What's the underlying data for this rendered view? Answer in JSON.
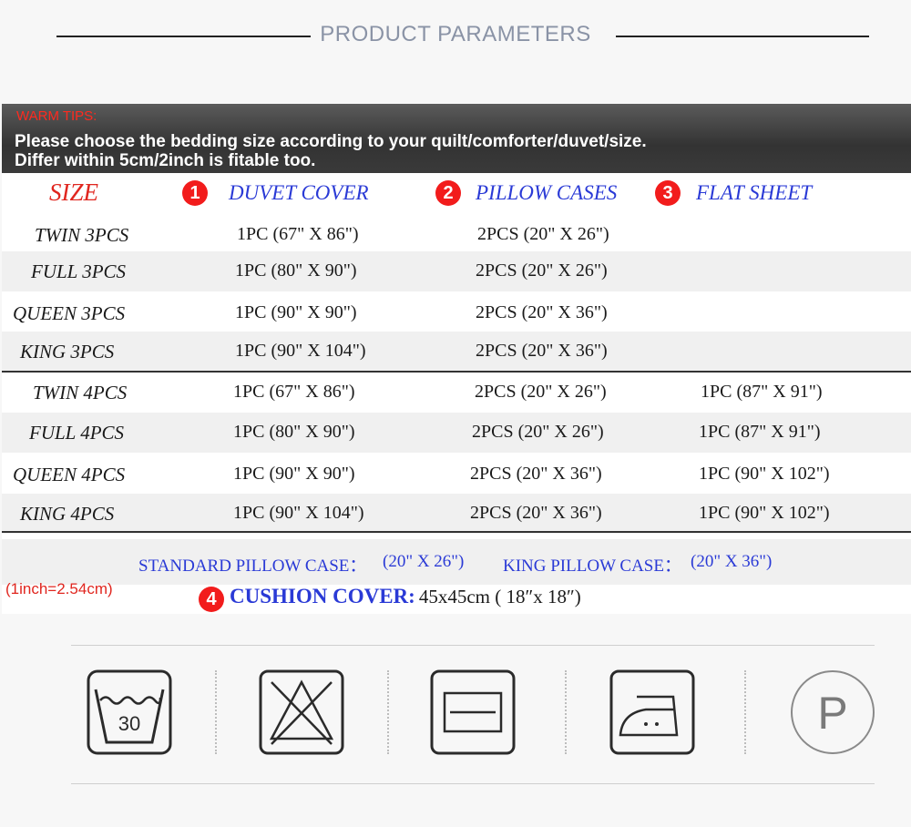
{
  "header": {
    "title": "PRODUCT PARAMETERS"
  },
  "tips": {
    "label": "WARM TIPS:",
    "line1": "Please choose the bedding size according to your quilt/comforter/duvet/size.",
    "line2": "Differ within 5cm/2inch is fitable too."
  },
  "columns": {
    "size": "SIZE",
    "c1_num": "1",
    "c1": "DUVET COVER",
    "c2_num": "2",
    "c2": "PILLOW CASES",
    "c3_num": "3",
    "c3": "FLAT SHEET"
  },
  "rows3": [
    {
      "size": "TWIN  3PCS",
      "duvet": "1PC (67\" X 86\")",
      "pillow": "2PCS (20\" X 26\")",
      "sheet": ""
    },
    {
      "size": "FULL 3PCS",
      "duvet": "1PC  (80\" X 90\")",
      "pillow": "2PCS (20\" X 26\")",
      "sheet": ""
    },
    {
      "size": "QUEEN 3PCS",
      "duvet": "1PC (90\" X 90\")",
      "pillow": "2PCS (20\" X 36\")",
      "sheet": ""
    },
    {
      "size": "KING  3PCS",
      "duvet": "1PC (90\" X 104\")",
      "pillow": "2PCS (20\" X 36\")",
      "sheet": ""
    }
  ],
  "rows4": [
    {
      "size": "TWIN  4PCS",
      "duvet": "1PC (67\" X 86\")",
      "pillow": "2PCS (20\" X 26\")",
      "sheet": "1PC (87\" X 91\")"
    },
    {
      "size": "FULL 4PCS",
      "duvet": "1PC (80\" X 90\")",
      "pillow": "2PCS (20\" X 26\")",
      "sheet": "1PC (87\" X 91\")"
    },
    {
      "size": "QUEEN 4PCS",
      "duvet": "1PC (90\" X 90\")",
      "pillow": "2PCS  (20\" X 36\")",
      "sheet": "1PC (90\" X 102\")"
    },
    {
      "size": "KING  4PCS",
      "duvet": "1PC (90\" X 104\")",
      "pillow": "2PCS  (20\" X 36\")",
      "sheet": "1PC (90\" X 102\")"
    }
  ],
  "standard": {
    "std_label": "STANDARD PILLOW CASE：",
    "std_value": "(20\" X 26\")",
    "king_label": "KING PILLOW CASE：",
    "king_value": "(20\" X 36\")"
  },
  "conversion": "(1inch=2.54cm)",
  "cushion": {
    "num": "4",
    "label": "CUSHION COVER:",
    "value": "45x45cm ( 18″x 18″)"
  },
  "care": {
    "wash_temp": "30",
    "icons": [
      "wash-30-icon",
      "do-not-bleach-icon",
      "dry-flat-icon",
      "iron-low-icon",
      "dry-clean-p-icon"
    ],
    "p_letter": "P"
  },
  "colors": {
    "accent_blue": "#2a3ad6",
    "accent_red": "#e0261f",
    "number_badge": "#f21c1c"
  }
}
